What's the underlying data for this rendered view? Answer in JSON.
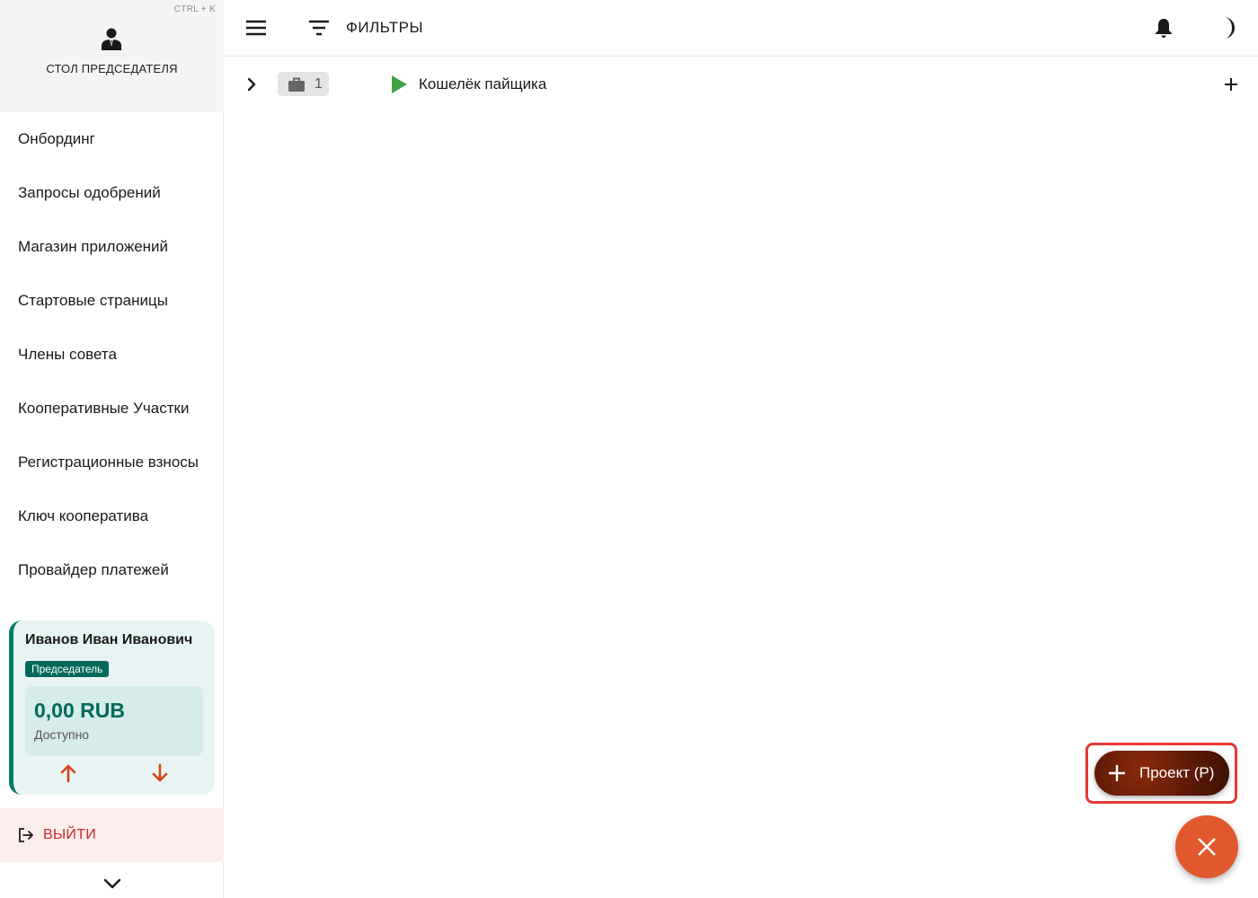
{
  "sidebar": {
    "shortcut_hint": "CTRL + K",
    "desk_title": "СТОЛ ПРЕДСЕДАТЕЛЯ",
    "desk_icon": "chairman-icon",
    "items": [
      {
        "label": "Онбординг"
      },
      {
        "label": "Запросы одобрений"
      },
      {
        "label": "Магазин приложений"
      },
      {
        "label": "Стартовые страницы"
      },
      {
        "label": "Члены совета"
      },
      {
        "label": "Кооперативные Участки"
      },
      {
        "label": "Регистрационные взносы"
      },
      {
        "label": "Ключ кооператива"
      },
      {
        "label": "Провайдер платежей"
      }
    ],
    "user": {
      "name": "Иванов Иван Иванович",
      "role": "Председатель",
      "balance": "0,00 RUB",
      "balance_label": "Доступно"
    },
    "logout_label": "ВЫЙТИ"
  },
  "topbar": {
    "filter_label": "ФИЛЬТРЫ"
  },
  "row": {
    "count": "1",
    "title": "Кошелёк пайщика"
  },
  "fab": {
    "project_label": "Проект (P)"
  },
  "colors": {
    "accent_teal": "#00695c",
    "logout_red": "#c62828",
    "fab_orange": "#e2582e",
    "project_brown": "#5e1a06",
    "play_green": "#43a047",
    "highlight_red": "#e53935"
  }
}
